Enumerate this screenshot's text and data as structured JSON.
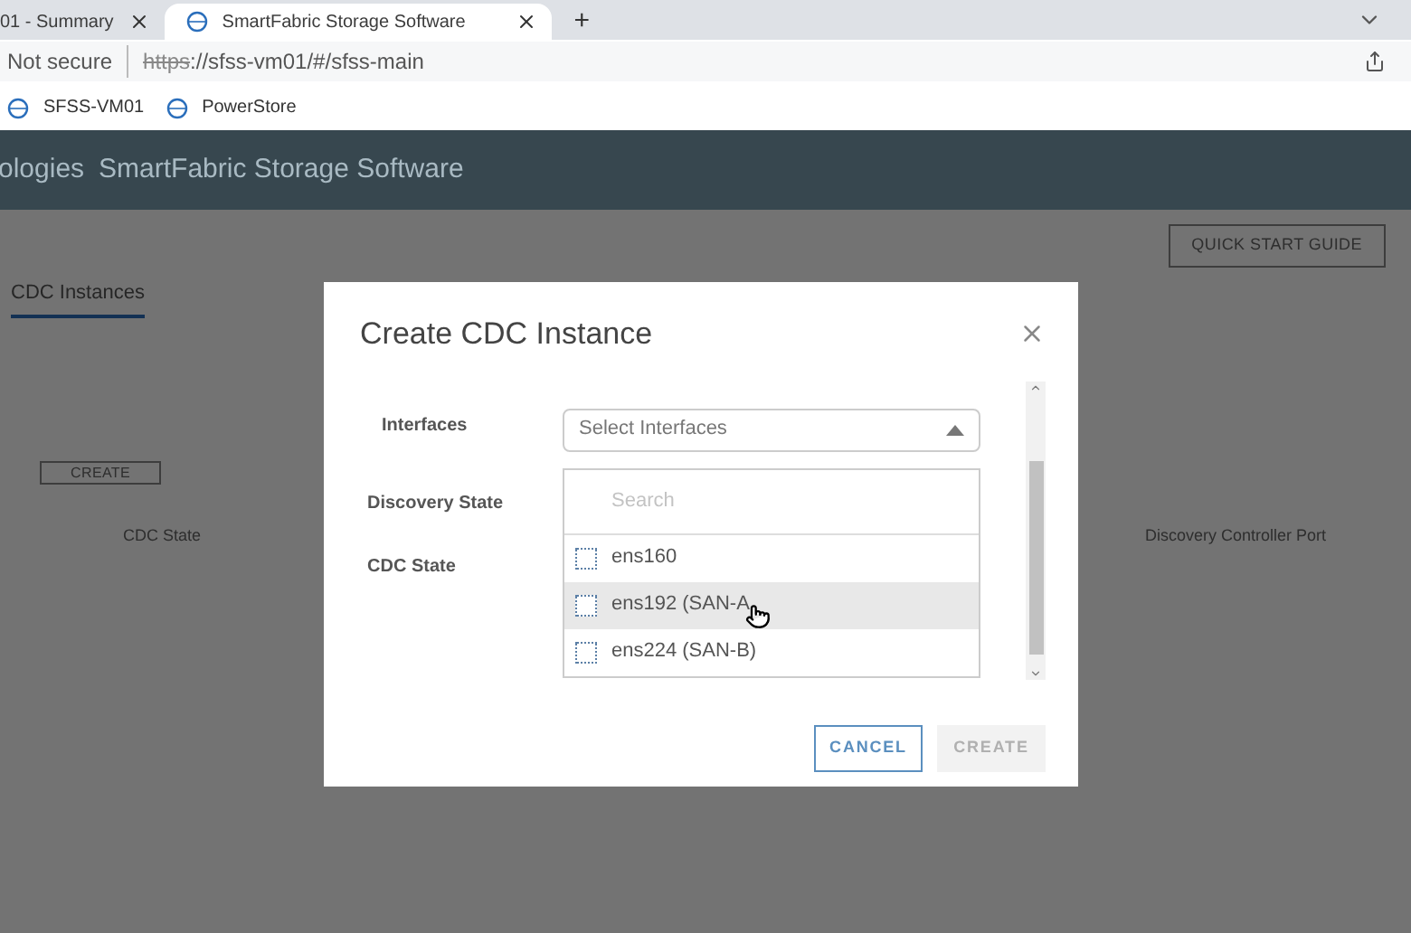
{
  "browser": {
    "tabs": [
      {
        "title": "01 - Summary",
        "selected": false
      },
      {
        "title": "SmartFabric Storage Software",
        "selected": true
      }
    ],
    "new_tab": "+",
    "security": "Not secure",
    "url_scheme": "https",
    "url_rest": "://sfss-vm01/#/sfss-main",
    "bookmarks": [
      "SFSS-VM01",
      "PowerStore"
    ]
  },
  "app": {
    "brand": "ologies",
    "product": "SmartFabric Storage Software",
    "quick_start": "QUICK START GUIDE",
    "tabs": [
      {
        "label": "CDC Instances",
        "selected": true
      }
    ],
    "create_button": "CREATE",
    "columns": [
      "CDC State",
      "Discovery Controller Port"
    ]
  },
  "dialog": {
    "title": "Create CDC Instance",
    "fields": [
      {
        "label": "Interfaces",
        "kind": "select",
        "placeholder": "Select Interfaces",
        "expanded": true
      },
      {
        "label": "Discovery State",
        "kind": "text"
      },
      {
        "label": "CDC State",
        "kind": "text"
      }
    ],
    "dropdown": {
      "search_placeholder": "Search",
      "options": [
        {
          "label": "ens160",
          "checked": false,
          "hovered": false
        },
        {
          "label": "ens192 (SAN-A",
          "checked": false,
          "hovered": true
        },
        {
          "label": "ens224 (SAN-B)",
          "checked": false,
          "hovered": false
        }
      ]
    },
    "buttons": [
      {
        "label": "CANCEL",
        "disabled": false
      },
      {
        "label": "CREATE",
        "disabled": true
      }
    ]
  }
}
